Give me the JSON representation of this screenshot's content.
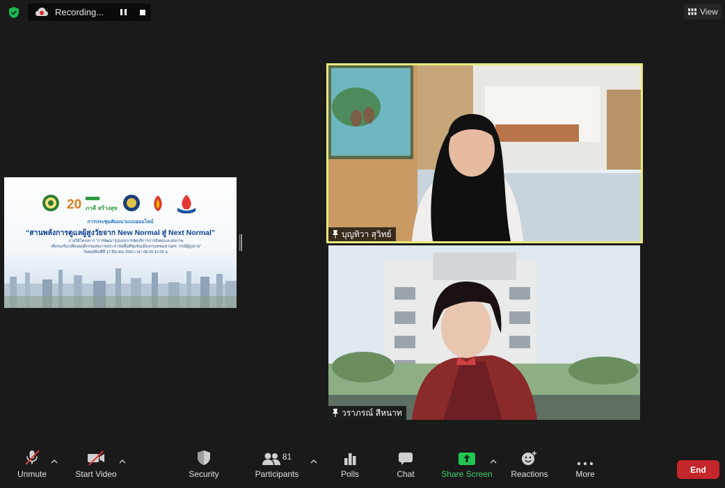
{
  "top_bar": {
    "recording_label": "Recording...",
    "view_label": "View"
  },
  "shared_screen": {
    "anniversary_text": "20",
    "anniversary_sub": "ภาคี สร้างสุข",
    "subtitle": "การประชุมสัมมนาแบบออนไลน์",
    "title": "“สานพลังการดูแลผู้สูงวัยจาก New Normal สู่ Next Normal”",
    "project_line1": "ภายใต้โครงการ “การพัฒนารูปแบบการจัดบริการการสังคมและสุขภาพ",
    "project_line2": "เพื่อรองรับเปลี่ยนพฤติกรรมสุขภาพประชาชนพื้นที่ชุมชนเมืองกรุงเทพมหานคร: กรณีผู้สูงอายุ”",
    "date_line": "วันพฤหัสบดีที่ 17 มีนาคม 2565 เวลา 08.00-12.00 น."
  },
  "participants": [
    {
      "name": "บุญทิวา สุวิทย์"
    },
    {
      "name": "วราภรณ์ สีหนาท"
    }
  ],
  "toolbar": {
    "unmute_label": "Unmute",
    "start_video_label": "Start Video",
    "security_label": "Security",
    "participants_label": "Participants",
    "participants_count": "81",
    "polls_label": "Polls",
    "chat_label": "Chat",
    "share_screen_label": "Share Screen",
    "reactions_label": "Reactions",
    "more_label": "More",
    "end_label": "End"
  },
  "colors": {
    "background": "#1a1a1a",
    "active_speaker_border": "#e6ea7c",
    "share_screen_green": "#23c552",
    "end_red": "#c4262b",
    "muted_red": "#e0393e"
  }
}
